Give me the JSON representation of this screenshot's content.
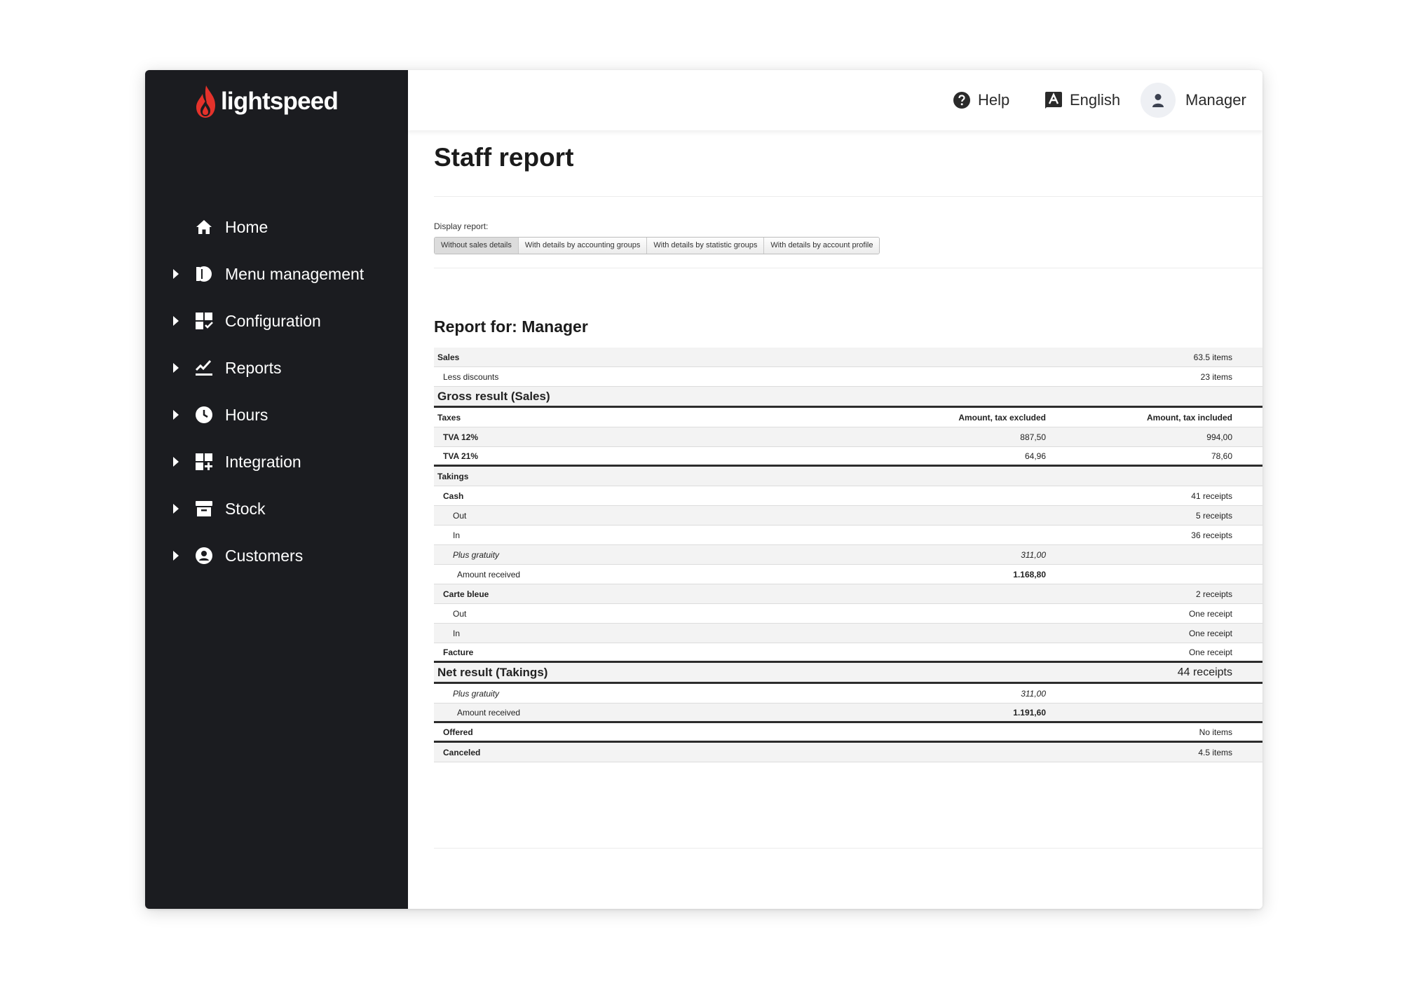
{
  "brand": {
    "name": "lightspeed",
    "accent": "#e4322b",
    "sidebar_bg": "#1b1c20"
  },
  "sidebar": {
    "items": [
      {
        "label": "Home",
        "icon": "home-icon",
        "expandable": false
      },
      {
        "label": "Menu management",
        "icon": "menu-management-icon",
        "expandable": true
      },
      {
        "label": "Configuration",
        "icon": "configuration-icon",
        "expandable": true
      },
      {
        "label": "Reports",
        "icon": "reports-icon",
        "expandable": true
      },
      {
        "label": "Hours",
        "icon": "clock-icon",
        "expandable": true
      },
      {
        "label": "Integration",
        "icon": "integration-icon",
        "expandable": true
      },
      {
        "label": "Stock",
        "icon": "stock-icon",
        "expandable": true
      },
      {
        "label": "Customers",
        "icon": "customers-icon",
        "expandable": true
      }
    ]
  },
  "header": {
    "help_label": "Help",
    "language_label": "English",
    "user_label": "Manager"
  },
  "page": {
    "title": "Staff report",
    "display_label": "Display report:",
    "tabs": [
      {
        "label": "Without sales details",
        "active": true
      },
      {
        "label": "With details by accounting groups",
        "active": false
      },
      {
        "label": "With details by statistic groups",
        "active": false
      },
      {
        "label": "With details by account profile",
        "active": false
      }
    ],
    "report_title": "Report for: Manager"
  },
  "report": {
    "rows": [
      {
        "type": "row",
        "level": 0,
        "label": "Sales",
        "label_bold": true,
        "mid": "",
        "right": "63.5 items",
        "alt": true
      },
      {
        "type": "row",
        "level": 1,
        "label": "Less discounts",
        "mid": "",
        "right": "23 items",
        "alt": false
      },
      {
        "type": "section",
        "level": 0,
        "label": "Gross result (Sales)",
        "mid": "",
        "right": "",
        "alt": true
      },
      {
        "type": "row",
        "level": 0,
        "label": "Taxes",
        "label_bold": true,
        "mid": "Amount, tax excluded",
        "mid_bold": true,
        "right": "Amount, tax included",
        "right_bold": true,
        "alt": false
      },
      {
        "type": "row",
        "level": 1,
        "label": "TVA 12%",
        "label_bold": true,
        "mid": "887,50",
        "right": "994,00",
        "alt": true
      },
      {
        "type": "row",
        "level": 1,
        "label": "TVA 21%",
        "label_bold": true,
        "mid": "64,96",
        "right": "78,60",
        "alt": false,
        "thick": true
      },
      {
        "type": "row",
        "level": 0,
        "label": "Takings",
        "label_bold": true,
        "mid": "",
        "right": "",
        "alt": true
      },
      {
        "type": "row",
        "level": 1,
        "label": "Cash",
        "label_bold": true,
        "mid": "",
        "right": "41 receipts",
        "alt": false
      },
      {
        "type": "row",
        "level": 2,
        "label": "Out",
        "mid": "",
        "right": "5 receipts",
        "alt": true
      },
      {
        "type": "row",
        "level": 2,
        "label": "In",
        "mid": "",
        "right": "36 receipts",
        "alt": false
      },
      {
        "type": "row",
        "level": 2,
        "label": "Plus gratuity",
        "label_italic": true,
        "mid": "311,00",
        "mid_italic": true,
        "right": "",
        "alt": true
      },
      {
        "type": "row",
        "level": 3,
        "label": "Amount received",
        "mid": "1.168,80",
        "mid_bold": true,
        "right": "",
        "alt": false
      },
      {
        "type": "row",
        "level": 1,
        "label": "Carte bleue",
        "label_bold": true,
        "mid": "",
        "right": "2 receipts",
        "alt": true
      },
      {
        "type": "row",
        "level": 2,
        "label": "Out",
        "mid": "",
        "right": "One receipt",
        "alt": false
      },
      {
        "type": "row",
        "level": 2,
        "label": "In",
        "mid": "",
        "right": "One receipt",
        "alt": true
      },
      {
        "type": "row",
        "level": 1,
        "label": "Facture",
        "label_bold": true,
        "mid": "",
        "right": "One receipt",
        "alt": false,
        "thick": true
      },
      {
        "type": "section",
        "level": 0,
        "label": "Net result (Takings)",
        "mid": "",
        "right": "44 receipts",
        "alt": true
      },
      {
        "type": "row",
        "level": 2,
        "label": "Plus gratuity",
        "label_italic": true,
        "mid": "311,00",
        "mid_italic": true,
        "right": "",
        "alt": false
      },
      {
        "type": "row",
        "level": 3,
        "label": "Amount received",
        "mid": "1.191,60",
        "mid_bold": true,
        "right": "",
        "alt": true,
        "thick": true
      },
      {
        "type": "row",
        "level": 1,
        "label": "Offered",
        "label_bold": true,
        "mid": "",
        "right": "No items",
        "alt": false,
        "thick": true
      },
      {
        "type": "row",
        "level": 1,
        "label": "Canceled",
        "label_bold": true,
        "mid": "",
        "right": "4.5 items",
        "alt": true
      }
    ]
  }
}
